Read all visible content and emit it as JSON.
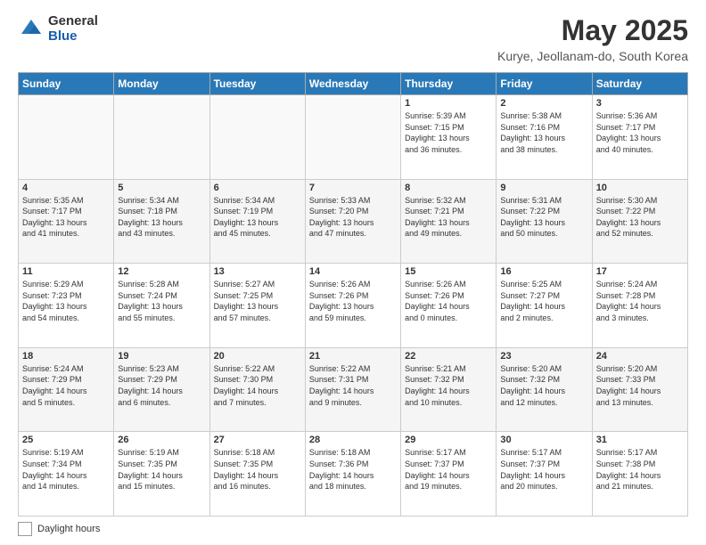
{
  "header": {
    "logo_general": "General",
    "logo_blue": "Blue",
    "title": "May 2025",
    "subtitle": "Kurye, Jeollanam-do, South Korea"
  },
  "weekdays": [
    "Sunday",
    "Monday",
    "Tuesday",
    "Wednesday",
    "Thursday",
    "Friday",
    "Saturday"
  ],
  "weeks": [
    [
      {
        "day": "",
        "info": ""
      },
      {
        "day": "",
        "info": ""
      },
      {
        "day": "",
        "info": ""
      },
      {
        "day": "",
        "info": ""
      },
      {
        "day": "1",
        "info": "Sunrise: 5:39 AM\nSunset: 7:15 PM\nDaylight: 13 hours\nand 36 minutes."
      },
      {
        "day": "2",
        "info": "Sunrise: 5:38 AM\nSunset: 7:16 PM\nDaylight: 13 hours\nand 38 minutes."
      },
      {
        "day": "3",
        "info": "Sunrise: 5:36 AM\nSunset: 7:17 PM\nDaylight: 13 hours\nand 40 minutes."
      }
    ],
    [
      {
        "day": "4",
        "info": "Sunrise: 5:35 AM\nSunset: 7:17 PM\nDaylight: 13 hours\nand 41 minutes."
      },
      {
        "day": "5",
        "info": "Sunrise: 5:34 AM\nSunset: 7:18 PM\nDaylight: 13 hours\nand 43 minutes."
      },
      {
        "day": "6",
        "info": "Sunrise: 5:34 AM\nSunset: 7:19 PM\nDaylight: 13 hours\nand 45 minutes."
      },
      {
        "day": "7",
        "info": "Sunrise: 5:33 AM\nSunset: 7:20 PM\nDaylight: 13 hours\nand 47 minutes."
      },
      {
        "day": "8",
        "info": "Sunrise: 5:32 AM\nSunset: 7:21 PM\nDaylight: 13 hours\nand 49 minutes."
      },
      {
        "day": "9",
        "info": "Sunrise: 5:31 AM\nSunset: 7:22 PM\nDaylight: 13 hours\nand 50 minutes."
      },
      {
        "day": "10",
        "info": "Sunrise: 5:30 AM\nSunset: 7:22 PM\nDaylight: 13 hours\nand 52 minutes."
      }
    ],
    [
      {
        "day": "11",
        "info": "Sunrise: 5:29 AM\nSunset: 7:23 PM\nDaylight: 13 hours\nand 54 minutes."
      },
      {
        "day": "12",
        "info": "Sunrise: 5:28 AM\nSunset: 7:24 PM\nDaylight: 13 hours\nand 55 minutes."
      },
      {
        "day": "13",
        "info": "Sunrise: 5:27 AM\nSunset: 7:25 PM\nDaylight: 13 hours\nand 57 minutes."
      },
      {
        "day": "14",
        "info": "Sunrise: 5:26 AM\nSunset: 7:26 PM\nDaylight: 13 hours\nand 59 minutes."
      },
      {
        "day": "15",
        "info": "Sunrise: 5:26 AM\nSunset: 7:26 PM\nDaylight: 14 hours\nand 0 minutes."
      },
      {
        "day": "16",
        "info": "Sunrise: 5:25 AM\nSunset: 7:27 PM\nDaylight: 14 hours\nand 2 minutes."
      },
      {
        "day": "17",
        "info": "Sunrise: 5:24 AM\nSunset: 7:28 PM\nDaylight: 14 hours\nand 3 minutes."
      }
    ],
    [
      {
        "day": "18",
        "info": "Sunrise: 5:24 AM\nSunset: 7:29 PM\nDaylight: 14 hours\nand 5 minutes."
      },
      {
        "day": "19",
        "info": "Sunrise: 5:23 AM\nSunset: 7:29 PM\nDaylight: 14 hours\nand 6 minutes."
      },
      {
        "day": "20",
        "info": "Sunrise: 5:22 AM\nSunset: 7:30 PM\nDaylight: 14 hours\nand 7 minutes."
      },
      {
        "day": "21",
        "info": "Sunrise: 5:22 AM\nSunset: 7:31 PM\nDaylight: 14 hours\nand 9 minutes."
      },
      {
        "day": "22",
        "info": "Sunrise: 5:21 AM\nSunset: 7:32 PM\nDaylight: 14 hours\nand 10 minutes."
      },
      {
        "day": "23",
        "info": "Sunrise: 5:20 AM\nSunset: 7:32 PM\nDaylight: 14 hours\nand 12 minutes."
      },
      {
        "day": "24",
        "info": "Sunrise: 5:20 AM\nSunset: 7:33 PM\nDaylight: 14 hours\nand 13 minutes."
      }
    ],
    [
      {
        "day": "25",
        "info": "Sunrise: 5:19 AM\nSunset: 7:34 PM\nDaylight: 14 hours\nand 14 minutes."
      },
      {
        "day": "26",
        "info": "Sunrise: 5:19 AM\nSunset: 7:35 PM\nDaylight: 14 hours\nand 15 minutes."
      },
      {
        "day": "27",
        "info": "Sunrise: 5:18 AM\nSunset: 7:35 PM\nDaylight: 14 hours\nand 16 minutes."
      },
      {
        "day": "28",
        "info": "Sunrise: 5:18 AM\nSunset: 7:36 PM\nDaylight: 14 hours\nand 18 minutes."
      },
      {
        "day": "29",
        "info": "Sunrise: 5:17 AM\nSunset: 7:37 PM\nDaylight: 14 hours\nand 19 minutes."
      },
      {
        "day": "30",
        "info": "Sunrise: 5:17 AM\nSunset: 7:37 PM\nDaylight: 14 hours\nand 20 minutes."
      },
      {
        "day": "31",
        "info": "Sunrise: 5:17 AM\nSunset: 7:38 PM\nDaylight: 14 hours\nand 21 minutes."
      }
    ]
  ],
  "footer": {
    "label": "Daylight hours"
  }
}
